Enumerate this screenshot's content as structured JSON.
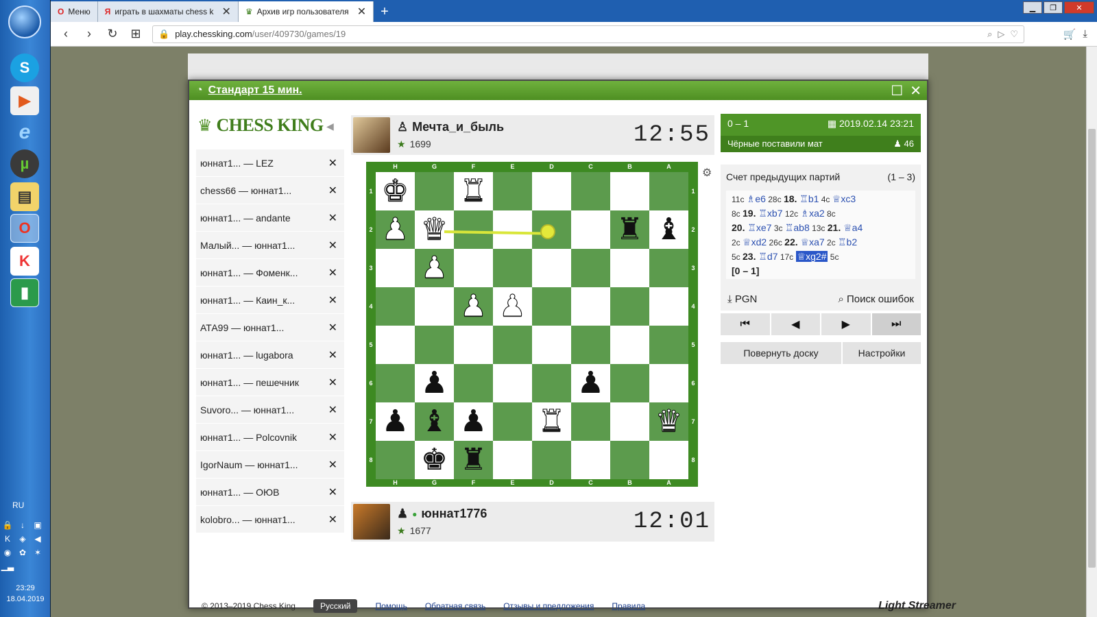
{
  "taskbar": {
    "lang": "RU",
    "time": "23:29",
    "date": "18.04.2019",
    "icons": [
      "start-orb",
      "skype",
      "media-player",
      "internet-explorer",
      "utorrent",
      "file-manager",
      "opera",
      "kaspersky",
      "chart-app"
    ]
  },
  "browser": {
    "tabs": [
      {
        "label": "Меню",
        "icon": "opera-icon"
      },
      {
        "label": "играть в шахматы chess k",
        "icon": "yandex-icon"
      },
      {
        "label": "Архив игр пользователя",
        "icon": "chess-king-icon"
      }
    ],
    "url_domain": "play.chessking.com",
    "url_path": "/user/409730/games/19"
  },
  "dialog": {
    "title": "Стандарт 15 мин."
  },
  "logo": {
    "name": "CHESS KING"
  },
  "games": [
    {
      "label": "юннат1...   — LEZ"
    },
    {
      "label": "chess66 — юннат1..."
    },
    {
      "label": "юннат1...   — andante"
    },
    {
      "label": "Малый...   — юннат1..."
    },
    {
      "label": "юннат1...   — Фоменк..."
    },
    {
      "label": "юннат1...   — Каин_к..."
    },
    {
      "label": "АТА99 — юннат1..."
    },
    {
      "label": "юннат1...   — lugabora"
    },
    {
      "label": "юннат1...   — пешечник"
    },
    {
      "label": "Suvoro...   — юннат1..."
    },
    {
      "label": "юннат1...   — Polcovnik"
    },
    {
      "label": "IgorNaum — юннат1..."
    },
    {
      "label": "юннат1...   — ОЮВ"
    },
    {
      "label": "kolobro...   — юннат1..."
    }
  ],
  "top_player": {
    "name": "Мечта_и_быль",
    "rating": "1699",
    "clock": "12:55"
  },
  "bottom_player": {
    "name": "юннат1776",
    "rating": "1677",
    "clock": "12:01"
  },
  "board": {
    "files": [
      "H",
      "G",
      "F",
      "E",
      "D",
      "C",
      "B",
      "A"
    ],
    "ranks": [
      "1",
      "2",
      "3",
      "4",
      "5",
      "6",
      "7",
      "8"
    ],
    "pieces": [
      [
        "wK",
        "",
        "wR",
        "",
        "",
        "",
        "",
        ""
      ],
      [
        "wP",
        "wQ",
        "",
        "",
        "",
        "",
        "bR",
        "bB"
      ],
      [
        "",
        "wP",
        "",
        "",
        "",
        "",
        "",
        ""
      ],
      [
        "",
        "",
        "wP",
        "wP",
        "",
        "",
        "",
        ""
      ],
      [
        "",
        "",
        "",
        "",
        "",
        "",
        "",
        ""
      ],
      [
        "",
        "bP",
        "",
        "",
        "",
        "bP",
        "",
        ""
      ],
      [
        "bP",
        "bB",
        "bP",
        "",
        "wR",
        "",
        "",
        "wQ"
      ],
      [
        "",
        "bK",
        "bR",
        "",
        "",
        "",
        "",
        ""
      ]
    ]
  },
  "result": {
    "score": "0 – 1",
    "date": "2019.02.14 23:21",
    "status": "Чёрные поставили мат",
    "viewers": "46"
  },
  "previous": {
    "title": "Счет предыдущих партий",
    "score": "(1 – 3)"
  },
  "moves_text": [
    {
      "t": "c",
      "v": "11с "
    },
    {
      "t": "m",
      "v": "♗e6"
    },
    {
      "t": "c",
      "v": " 28с "
    },
    {
      "t": "n",
      "v": "18. "
    },
    {
      "t": "m",
      "v": "♖b1"
    },
    {
      "t": "c",
      "v": " 4с "
    },
    {
      "t": "m",
      "v": "♕xc3"
    },
    {
      "t": "br",
      "v": ""
    },
    {
      "t": "c",
      "v": "8с "
    },
    {
      "t": "n",
      "v": "19. "
    },
    {
      "t": "m",
      "v": "♖xb7"
    },
    {
      "t": "c",
      "v": " 12с "
    },
    {
      "t": "m",
      "v": "♗xa2"
    },
    {
      "t": "c",
      "v": " 8с"
    },
    {
      "t": "br",
      "v": ""
    },
    {
      "t": "n",
      "v": "20. "
    },
    {
      "t": "m",
      "v": "♖xe7"
    },
    {
      "t": "c",
      "v": " 3с "
    },
    {
      "t": "m",
      "v": "♖ab8"
    },
    {
      "t": "c",
      "v": " 13с "
    },
    {
      "t": "n",
      "v": "21. "
    },
    {
      "t": "m",
      "v": "♕a4"
    },
    {
      "t": "br",
      "v": ""
    },
    {
      "t": "c",
      "v": "2с "
    },
    {
      "t": "m",
      "v": "♕xd2"
    },
    {
      "t": "c",
      "v": " 26с "
    },
    {
      "t": "n",
      "v": "22. "
    },
    {
      "t": "m",
      "v": "♕xa7"
    },
    {
      "t": "c",
      "v": " 2с "
    },
    {
      "t": "m",
      "v": "♖b2"
    },
    {
      "t": "br",
      "v": ""
    },
    {
      "t": "c",
      "v": "5с "
    },
    {
      "t": "n",
      "v": "23. "
    },
    {
      "t": "m",
      "v": "♖d7"
    },
    {
      "t": "c",
      "v": " 17с "
    },
    {
      "t": "cur",
      "v": "♕xg2#"
    },
    {
      "t": "c",
      "v": " 5с"
    },
    {
      "t": "br",
      "v": ""
    },
    {
      "t": "res",
      "v": "[0 – 1]"
    }
  ],
  "pgn_label": "PGN",
  "find_errors_label": "Поиск ошибок",
  "flip_label": "Повернуть доску",
  "settings_label": "Настройки",
  "footer": {
    "copyright": "© 2013–2019 Chess King",
    "language": "Русский",
    "help": "Помощь",
    "feedback": "Обратная связь",
    "reviews": "Отзывы и предложения",
    "rules": "Правила",
    "powered": "Light Streamer"
  }
}
